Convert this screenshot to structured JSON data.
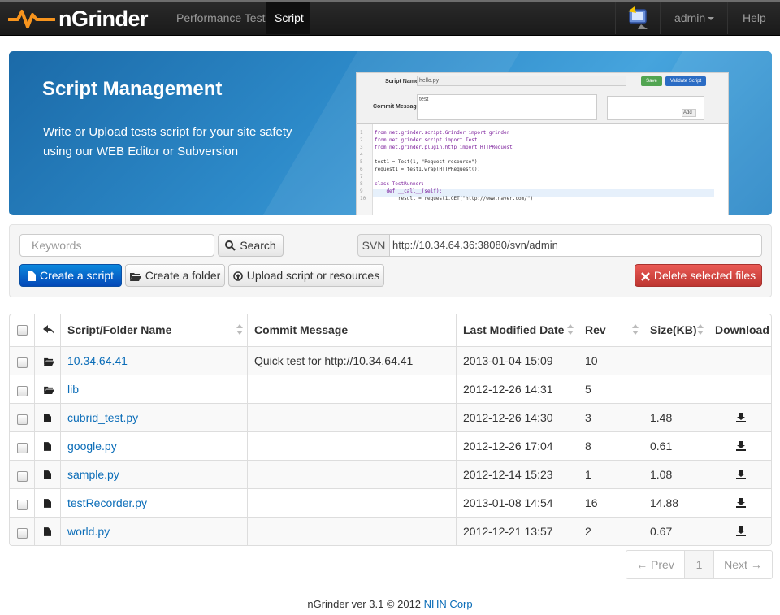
{
  "navbar": {
    "brand": "nGrinder",
    "items": [
      {
        "label": "Performance Test"
      },
      {
        "label": "Script",
        "active": true
      }
    ],
    "user": "admin",
    "help": "Help"
  },
  "banner": {
    "title": "Script Management",
    "line1": "Write or Upload tests script for your site safety",
    "line2": "using our WEB Editor or Subversion",
    "preview": {
      "script_name_label": "Script Name",
      "script_name_value": "hello.py",
      "commit_label": "Commit Message",
      "commit_value": "test",
      "save": "Save",
      "validate": "Validate Script",
      "add": "Add",
      "code": [
        {
          "n": "1",
          "text": "from net.grinder.script.Grinder import grinder"
        },
        {
          "n": "2",
          "text": "from net.grinder.script import Test"
        },
        {
          "n": "3",
          "text": "from net.grinder.plugin.http import HTTPRequest"
        },
        {
          "n": "4",
          "text": ""
        },
        {
          "n": "5",
          "text": "test1 = Test(1, \"Request resource\")"
        },
        {
          "n": "6",
          "text": "request1 = test1.wrap(HTTPRequest())"
        },
        {
          "n": "7",
          "text": ""
        },
        {
          "n": "8",
          "text": "class TestRunner:"
        },
        {
          "n": "9",
          "text": "    def __call__(self):"
        },
        {
          "n": "10",
          "text": "        result = request1.GET(\"http://www.naver.com/\")"
        }
      ]
    }
  },
  "toolbar": {
    "keywords_placeholder": "Keywords",
    "search": "Search",
    "svn_label": "SVN",
    "svn_url": "http://10.34.64.36:38080/svn/admin",
    "create_script": "Create a script",
    "create_folder": "Create a folder",
    "upload": "Upload script or resources",
    "delete": "Delete selected files"
  },
  "table": {
    "headers": {
      "name": "Script/Folder Name",
      "commit": "Commit Message",
      "date": "Last Modified Date",
      "rev": "Rev",
      "size": "Size(KB)",
      "download": "Download"
    },
    "rows": [
      {
        "type": "folder",
        "name": "10.34.64.41",
        "commit": "Quick test for http://10.34.64.41",
        "date": "2013-01-04 15:09",
        "rev": "10",
        "size": "",
        "download": false
      },
      {
        "type": "folder",
        "name": "lib",
        "commit": "",
        "date": "2012-12-26 14:31",
        "rev": "5",
        "size": "",
        "download": false
      },
      {
        "type": "file",
        "name": "cubrid_test.py",
        "commit": "",
        "date": "2012-12-26 14:30",
        "rev": "3",
        "size": "1.48",
        "download": true
      },
      {
        "type": "file",
        "name": "google.py",
        "commit": "",
        "date": "2012-12-26 17:04",
        "rev": "8",
        "size": "0.61",
        "download": true
      },
      {
        "type": "file",
        "name": "sample.py",
        "commit": "",
        "date": "2012-12-14 15:23",
        "rev": "1",
        "size": "1.08",
        "download": true
      },
      {
        "type": "file",
        "name": "testRecorder.py",
        "commit": "",
        "date": "2013-01-08 14:54",
        "rev": "16",
        "size": "14.88",
        "download": true
      },
      {
        "type": "file",
        "name": "world.py",
        "commit": "",
        "date": "2012-12-21 13:57",
        "rev": "2",
        "size": "0.67",
        "download": true
      }
    ]
  },
  "pagination": {
    "prev": "← Prev",
    "page": "1",
    "next": "Next →"
  },
  "footer": {
    "text": "nGrinder ver 3.1 © 2012",
    "link": "NHN Corp"
  },
  "colors": {
    "primary": "#0a6fd1",
    "danger": "#d9534f",
    "link": "#0b6db8",
    "brand_orange": "#f7941d"
  }
}
